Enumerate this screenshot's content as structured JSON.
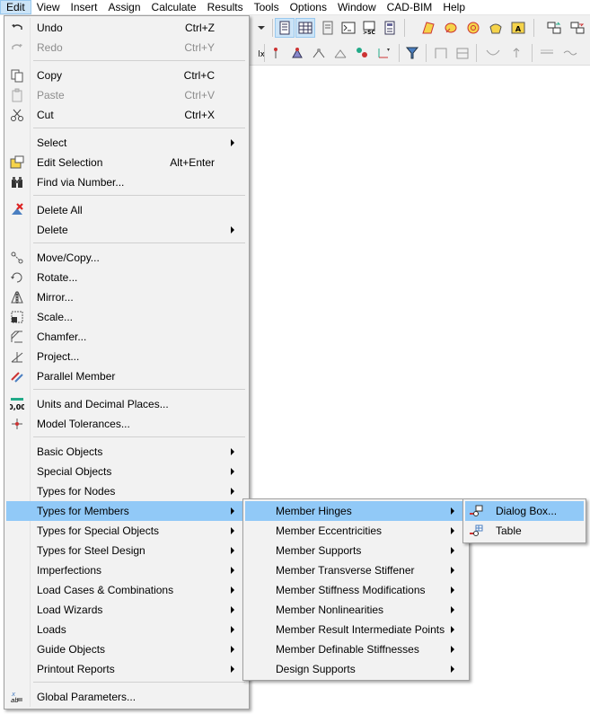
{
  "menubar": {
    "items": [
      "Edit",
      "View",
      "Insert",
      "Assign",
      "Calculate",
      "Results",
      "Tools",
      "Options",
      "Window",
      "CAD-BIM",
      "Help"
    ]
  },
  "edit_menu": {
    "undo": {
      "label": "Undo",
      "shortcut": "Ctrl+Z"
    },
    "redo": {
      "label": "Redo",
      "shortcut": "Ctrl+Y"
    },
    "copy": {
      "label": "Copy",
      "shortcut": "Ctrl+C"
    },
    "paste": {
      "label": "Paste",
      "shortcut": "Ctrl+V"
    },
    "cut": {
      "label": "Cut",
      "shortcut": "Ctrl+X"
    },
    "select": {
      "label": "Select"
    },
    "edit_selection": {
      "label": "Edit Selection",
      "shortcut": "Alt+Enter"
    },
    "find_via_number": {
      "label": "Find via Number..."
    },
    "delete_all": {
      "label": "Delete All"
    },
    "delete": {
      "label": "Delete"
    },
    "move_copy": {
      "label": "Move/Copy..."
    },
    "rotate": {
      "label": "Rotate..."
    },
    "mirror": {
      "label": "Mirror..."
    },
    "scale": {
      "label": "Scale..."
    },
    "chamfer": {
      "label": "Chamfer..."
    },
    "project": {
      "label": "Project..."
    },
    "parallel_member": {
      "label": "Parallel Member"
    },
    "units": {
      "label": "Units and Decimal Places..."
    },
    "tolerances": {
      "label": "Model Tolerances..."
    },
    "basic_objects": {
      "label": "Basic Objects"
    },
    "special_objects": {
      "label": "Special Objects"
    },
    "types_nodes": {
      "label": "Types for Nodes"
    },
    "types_members": {
      "label": "Types for Members"
    },
    "types_special_objects": {
      "label": "Types for Special Objects"
    },
    "types_steel_design": {
      "label": "Types for Steel Design"
    },
    "imperfections": {
      "label": "Imperfections"
    },
    "load_cases": {
      "label": "Load Cases & Combinations"
    },
    "load_wizards": {
      "label": "Load Wizards"
    },
    "loads": {
      "label": "Loads"
    },
    "guide_objects": {
      "label": "Guide Objects"
    },
    "printout_reports": {
      "label": "Printout Reports"
    },
    "global_parameters": {
      "label": "Global Parameters..."
    }
  },
  "members_submenu": {
    "items": [
      "Member Hinges",
      "Member Eccentricities",
      "Member Supports",
      "Member Transverse Stiffener",
      "Member Stiffness Modifications",
      "Member Nonlinearities",
      "Member Result Intermediate Points",
      "Member Definable Stiffnesses",
      "Design Supports"
    ]
  },
  "hinges_submenu": {
    "dialog_box": "Dialog Box...",
    "table": "Table"
  },
  "colors": {
    "highlight": "#91c9f7",
    "menu_bg": "#f2f2f2",
    "toolbar_pressed": "#cce4f7"
  }
}
